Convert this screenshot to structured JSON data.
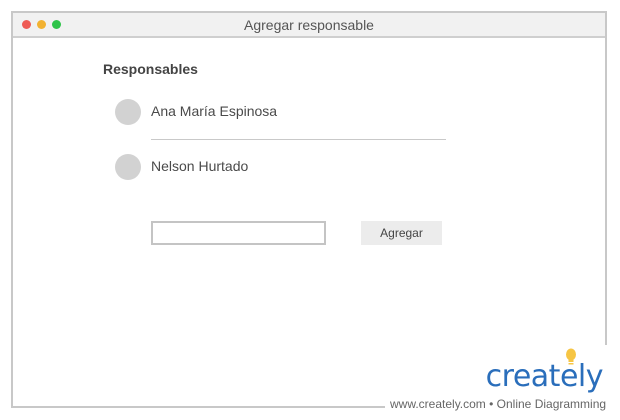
{
  "window": {
    "title": "Agregar responsable"
  },
  "section": {
    "title": "Responsables"
  },
  "responsables": [
    {
      "name": "Ana María Espinosa"
    },
    {
      "name": "Nelson Hurtado"
    }
  ],
  "add_form": {
    "input_value": "",
    "button_label": "Agregar"
  },
  "watermark": {
    "brand": "creately",
    "tagline": "www.creately.com • Online Diagramming"
  }
}
